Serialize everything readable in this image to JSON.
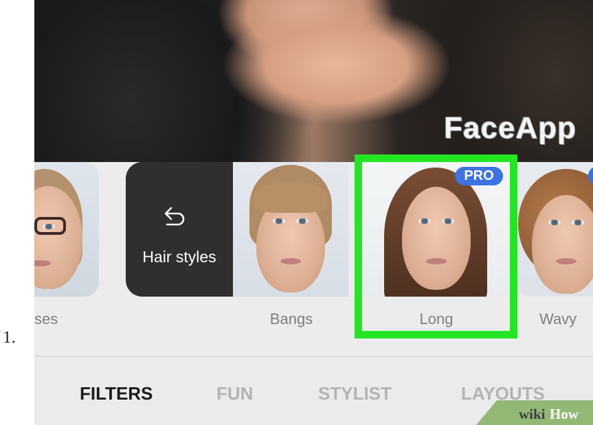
{
  "step": {
    "number": "1."
  },
  "photo": {
    "watermark": "FaceApp"
  },
  "filters": {
    "hair_styles_label": "Hair styles",
    "items": [
      {
        "label": "ses"
      },
      {
        "label": "Bangs"
      },
      {
        "label": "Long",
        "badge": "PRO",
        "selected": true
      },
      {
        "label": "Wavy"
      }
    ]
  },
  "tabs": [
    {
      "label": "FILTERS",
      "active": true
    },
    {
      "label": "FUN"
    },
    {
      "label": "STYLIST"
    },
    {
      "label": "LAYOUTS"
    }
  ],
  "watermark": {
    "prefix": "wiki",
    "suffix": "How"
  },
  "colors": {
    "selection_outline": "#22e622",
    "pro_badge": "#3c72e2",
    "hair_styles_card": "#2f2f2f"
  }
}
